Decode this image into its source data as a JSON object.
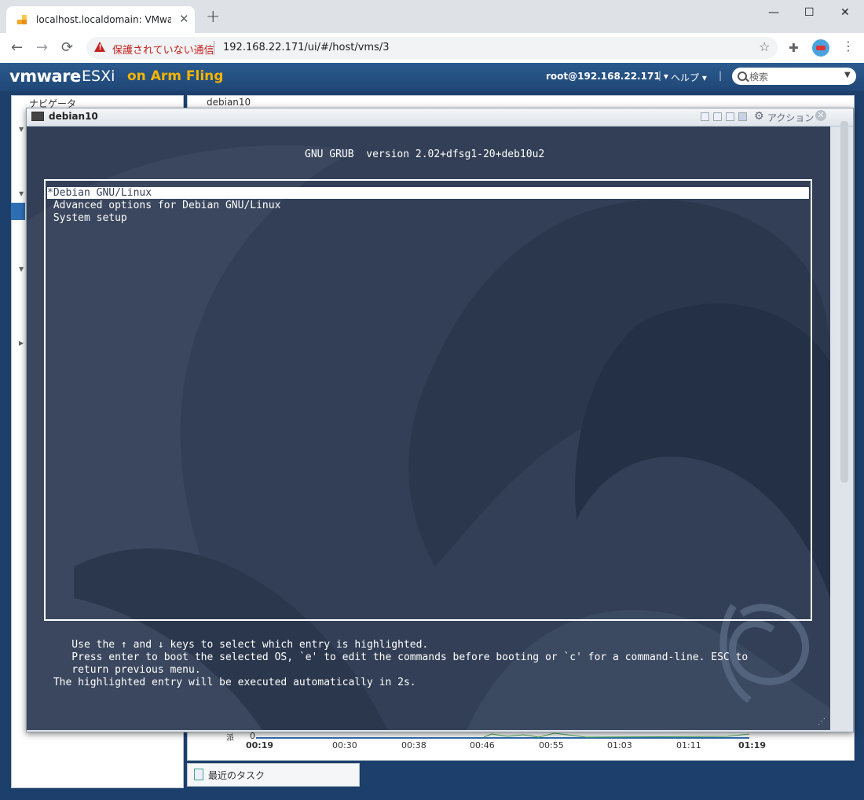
{
  "browser": {
    "tab_title": "localhost.localdomain: VMware ESXi",
    "tab_close": "✕",
    "new_tab": "+",
    "window_controls": {
      "minimize": "—",
      "maximize": "☐",
      "close": "✕"
    },
    "security_warning": "保護されていない通信",
    "url": "192.168.22.171/ui/#/host/vms/3",
    "nav": {
      "back": "←",
      "forward": "→",
      "reload": "⟳"
    }
  },
  "esxi_header": {
    "logo_vm": "vmware",
    "logo_esxi": "ESXi",
    "logo_fling": "on Arm Fling",
    "user": "root@192.168.22.171 ▾",
    "separator": "|",
    "help": "ヘルプ ▾",
    "search_placeholder": "検索"
  },
  "nav_panel": {
    "title": "ナビゲータ"
  },
  "main_panel": {
    "title": "debian10"
  },
  "console": {
    "title": "debian10",
    "action_label": "アクション",
    "grub": {
      "header": "GNU GRUB  version 2.02+dfsg1-20+deb10u2",
      "entries": [
        {
          "label": "*Debian GNU/Linux",
          "selected": true
        },
        {
          "label": " Advanced options for Debian GNU/Linux",
          "selected": false
        },
        {
          "label": " System setup",
          "selected": false
        }
      ],
      "help_line1": "    Use the ↑ and ↓ keys to select which entry is highlighted.",
      "help_line2": "    Press enter to boot the selected OS, `e' to edit the commands before booting or `c' for a command-line. ESC to",
      "help_line3": "    return previous menu.",
      "countdown": " The highlighted entry will be executed automatically in 2s."
    }
  },
  "graph": {
    "y_label": "派",
    "y_zero": "0",
    "x_ticks": [
      "00:19",
      "00:30",
      "00:38",
      "00:46",
      "00:55",
      "01:03",
      "01:11",
      "01:19"
    ],
    "colors": {
      "line_blue": "#2e6fb3",
      "line_green": "#4caf50"
    }
  },
  "taskbar": {
    "label": "最近のタスク"
  },
  "colors": {
    "grub_bg": "#323f56",
    "esxi_header": "#2b5a8e",
    "accent_fling": "#f5b400",
    "warning": "#c5221f"
  }
}
